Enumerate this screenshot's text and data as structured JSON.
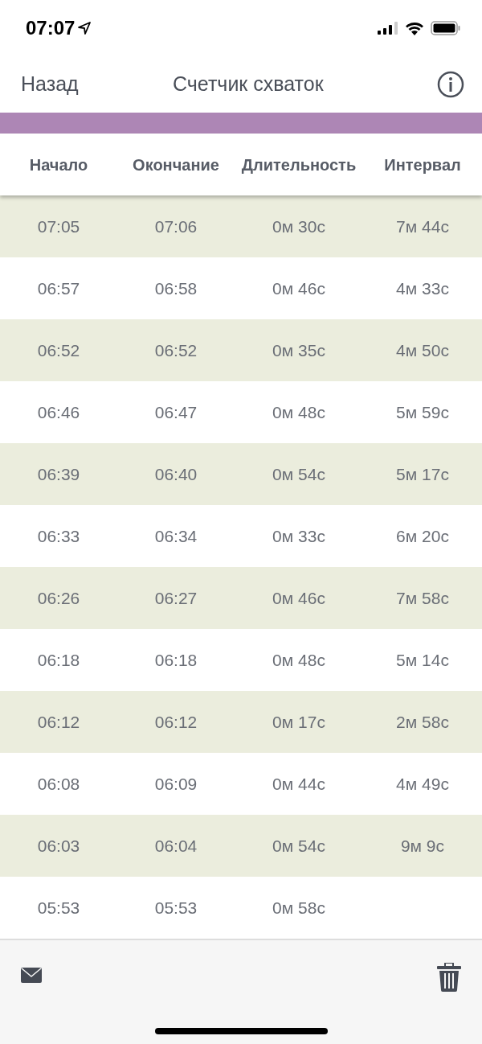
{
  "status_bar": {
    "time": "07:07"
  },
  "nav": {
    "back": "Назад",
    "title": "Счетчик схваток"
  },
  "table": {
    "columns": [
      "Начало",
      "Окончание",
      "Длительность",
      "Интервал"
    ],
    "rows": [
      [
        "07:05",
        "07:06",
        "0м 30с",
        "7м 44с"
      ],
      [
        "06:57",
        "06:58",
        "0м 46с",
        "4м 33с"
      ],
      [
        "06:52",
        "06:52",
        "0м 35с",
        "4м 50с"
      ],
      [
        "06:46",
        "06:47",
        "0м 48с",
        "5м 59с"
      ],
      [
        "06:39",
        "06:40",
        "0м 54с",
        "5м 17с"
      ],
      [
        "06:33",
        "06:34",
        "0м 33с",
        "6м 20с"
      ],
      [
        "06:26",
        "06:27",
        "0м 46с",
        "7м 58с"
      ],
      [
        "06:18",
        "06:18",
        "0м 48с",
        "5м 14с"
      ],
      [
        "06:12",
        "06:12",
        "0м 17с",
        "2м 58с"
      ],
      [
        "06:08",
        "06:09",
        "0м 44с",
        "4м 49с"
      ],
      [
        "06:03",
        "06:04",
        "0м 54с",
        "9м 9с"
      ],
      [
        "05:53",
        "05:53",
        "0м 58с"
      ]
    ]
  }
}
